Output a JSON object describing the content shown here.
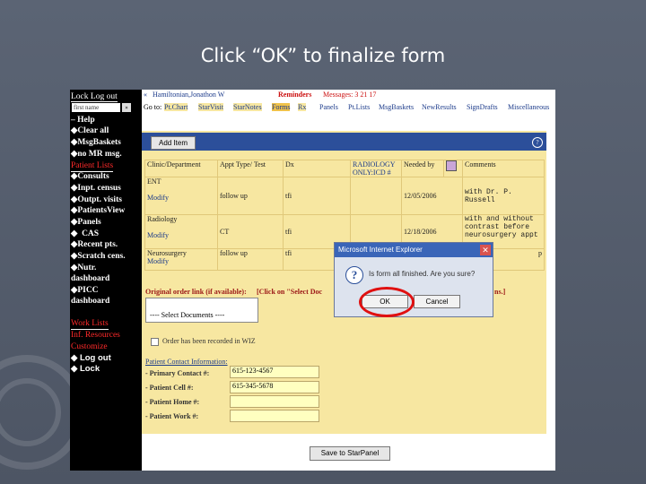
{
  "slide": {
    "title": "Click “OK” to finalize form"
  },
  "left_nav": {
    "top_links": "Lock  Log out",
    "search_value": "first name",
    "items": [
      {
        "label": "Help",
        "style": "white"
      },
      {
        "label": "Clear all",
        "style": "white"
      },
      {
        "label": "MsgBaskets",
        "style": "white"
      },
      {
        "label": "no MR msg.",
        "style": "white"
      },
      {
        "label": "Patient Lists",
        "style": "red"
      },
      {
        "label": "Consults",
        "style": "white"
      },
      {
        "label": "Inpt. census",
        "style": "white"
      },
      {
        "label": "Outpt. visits",
        "style": "white"
      },
      {
        "label": "PatientsView",
        "style": "white"
      },
      {
        "label": "Panels",
        "style": "white"
      },
      {
        "label": "CAS",
        "style": "white"
      },
      {
        "label": "Recent pts.",
        "style": "white"
      },
      {
        "label": "Scratch cens.",
        "style": "white"
      },
      {
        "label": "Nutr.",
        "style": "white"
      },
      {
        "label": "dashboard",
        "style": "white"
      },
      {
        "label": "PICC",
        "style": "white"
      },
      {
        "label": "dashboard",
        "style": "white"
      },
      {
        "label": "Work Lists",
        "style": "red"
      },
      {
        "label": "Inf. Resources",
        "style": "red"
      },
      {
        "label": "Customize",
        "style": "red"
      },
      {
        "label": "Log out",
        "style": "white"
      },
      {
        "label": "Lock",
        "style": "white"
      }
    ]
  },
  "header": {
    "patient": "Hamiltonian,Jonathon W",
    "reminders": "Reminders",
    "messages": "Messages: 3 21 17"
  },
  "toolbar": {
    "goto": "Go to:",
    "tabs": [
      "Pt.Chart",
      "StarVisit",
      "StarNotes",
      "Forms",
      "Rx"
    ],
    "right_tabs": [
      "Panels",
      "Pt.Lists",
      "MsgBaskets",
      "NewResults",
      "SignDrafts",
      "Miscellaneous"
    ]
  },
  "form": {
    "add_item": "Add Item",
    "columns": [
      "Clinic/Department",
      "Appt Type/ Test",
      "Dx",
      "RADIOLOGY ONLY:ICD #",
      "Needed by",
      "",
      "Comments"
    ],
    "rows": [
      {
        "clinic": "ENT",
        "modify": "Modify",
        "type": "follow up",
        "dx": "tfi",
        "icd": "",
        "needed": "12/05/2006",
        "comments": "with Dr. P. Russell"
      },
      {
        "clinic": "Radiology",
        "modify": "Modify",
        "type": "CT",
        "dx": "tfi",
        "icd": "",
        "needed": "12/18/2006",
        "comments": "with and without contrast before neurosurgery appt"
      },
      {
        "clinic": "Neurosurgery",
        "modify": "Modify",
        "type": "follow up",
        "dx": "tfi",
        "icd": "",
        "needed": "",
        "comments": "p"
      }
    ],
    "original_order_label": "Original order link (if available):",
    "click_hint": "[Click on \"Select Doc",
    "hint_tail": "ns.]",
    "select_docs": "---- Select Documents ----",
    "recorded_label": "Order has been recorded in WIZ",
    "contact_title": "Patient Contact Information:",
    "primary_label": "- Primary Contact #:",
    "primary_value": "615-123-4567",
    "cell_label": "- Patient Cell #:",
    "cell_value": "615-345-5678",
    "home_label": "- Patient Home #:",
    "home_value": "",
    "work_label": "- Patient Work #:",
    "work_value": "",
    "save_button": "Save to StarPanel"
  },
  "dialog": {
    "title": "Microsoft Internet Explorer",
    "message": "Is form all finished. Are you sure?",
    "ok": "OK",
    "cancel": "Cancel"
  }
}
